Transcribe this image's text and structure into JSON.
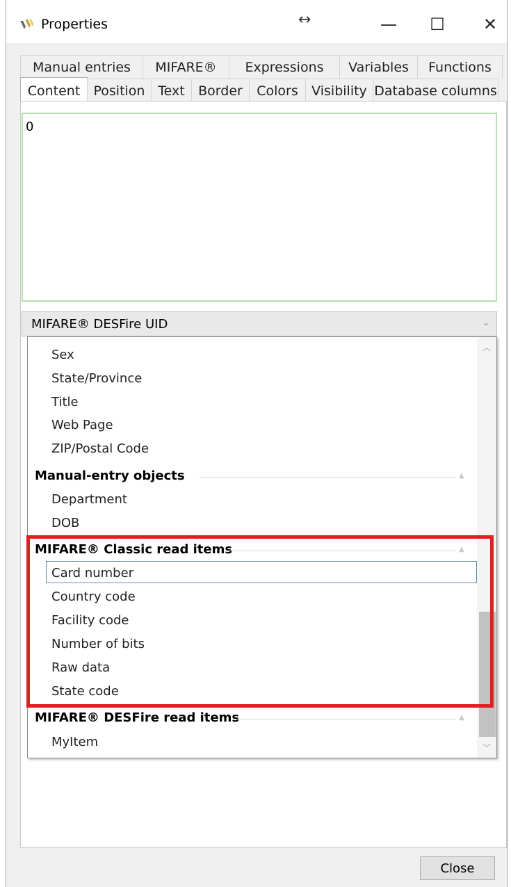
{
  "window": {
    "title": "Properties",
    "resize_glyph": "↔",
    "minimize_glyph": "—",
    "maximize_glyph": "☐",
    "close_glyph": "✕"
  },
  "tabs_row1": [
    "Manual entries",
    "MIFARE®",
    "Expressions",
    "Variables",
    "Functions"
  ],
  "tabs_row2": [
    "Content",
    "Position",
    "Text",
    "Border",
    "Colors",
    "Visibility",
    "Database columns"
  ],
  "active_tab": "Content",
  "content": {
    "text_value": "0",
    "combo_value": "MIFARE® DESFire UID",
    "combo_chevron": "⌄"
  },
  "dropdown": {
    "items_top": [
      "Sex",
      "State/Province",
      "Title",
      "Web Page",
      "ZIP/Postal Code"
    ],
    "groups": [
      {
        "name": "Manual-entry objects",
        "items": [
          "Department",
          "DOB"
        ]
      },
      {
        "name": "MIFARE® Classic read items",
        "items": [
          "Card number",
          "Country code",
          "Facility code",
          "Number of bits",
          "Raw data",
          "State code"
        ]
      },
      {
        "name": "MIFARE® DESFire read items",
        "items": [
          "MyItem"
        ]
      }
    ],
    "selected_item": "Card number",
    "scroll_up_glyph": "︿",
    "scroll_down_glyph": "﹀",
    "collapse_glyph": "▲"
  },
  "highlight_color": "#e02020",
  "footer": {
    "close_label": "Close"
  }
}
